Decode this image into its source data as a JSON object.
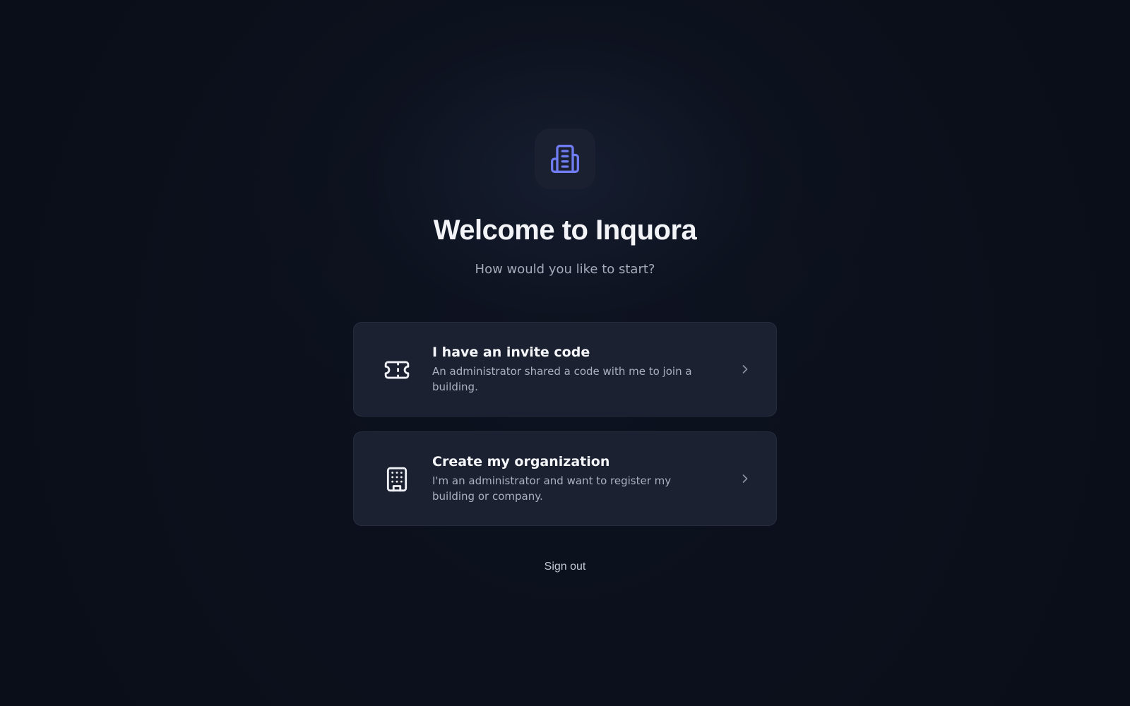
{
  "app": {
    "logo_icon": "building-icon",
    "accent_color": "#6f7cf2"
  },
  "header": {
    "title": "Welcome to Inquora",
    "subtitle": "How would you like to start?"
  },
  "options": [
    {
      "icon": "ticket-icon",
      "title": "I have an invite code",
      "description": "An administrator shared a code with me to join a building."
    },
    {
      "icon": "office-building-icon",
      "title": "Create my organization",
      "description": "I'm an administrator and want to register my building or company."
    }
  ],
  "footer": {
    "sign_out_label": "Sign out"
  }
}
